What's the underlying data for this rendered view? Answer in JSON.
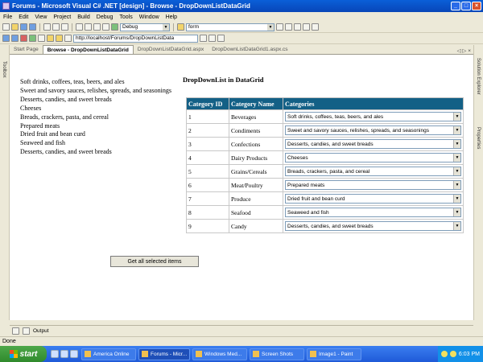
{
  "window": {
    "title": "Forums - Microsoft Visual C# .NET [design] - Browse - DropDownListDataGrid"
  },
  "menu": [
    "File",
    "Edit",
    "View",
    "Project",
    "Build",
    "Debug",
    "Tools",
    "Window",
    "Help"
  ],
  "toolbar": {
    "config": "Debug",
    "find": "form",
    "url": "http://localhost/Forums/DropDownListData"
  },
  "tabs": [
    "Start Page",
    "Browse - DropDownListDataGrid",
    "DropDownListDataGrid.aspx",
    "DropDownListDataGrid1.aspx.cs"
  ],
  "tab_controls": "◁ ▷ ×",
  "side": {
    "toolbox": "Toolbox",
    "solution": "Solution Explorer",
    "properties": "Properties"
  },
  "selected_list": [
    "Soft drinks, coffees, teas, beers, and ales",
    "Sweet and savory sauces, relishes, spreads, and seasonings",
    "Desserts, candies, and sweet breads",
    "Cheeses",
    "Breads, crackers, pasta, and cereal",
    "Prepared meats",
    "Dried fruit and bean curd",
    "Seaweed and fish",
    "Desserts, candies, and sweet breads"
  ],
  "grid": {
    "title": "DropDownList in DataGrid",
    "headers": [
      "Category ID",
      "Category Name",
      "Categories"
    ],
    "rows": [
      {
        "id": "1",
        "name": "Beverages",
        "selected": "Soft drinks, coffees, teas, beers, and ales"
      },
      {
        "id": "2",
        "name": "Condiments",
        "selected": "Sweet and savory sauces, relishes, spreads, and seasonings"
      },
      {
        "id": "3",
        "name": "Confections",
        "selected": "Desserts, candies, and sweet breads"
      },
      {
        "id": "4",
        "name": "Dairy Products",
        "selected": "Cheeses"
      },
      {
        "id": "5",
        "name": "Grains/Cereals",
        "selected": "Breads, crackers, pasta, and cereal"
      },
      {
        "id": "6",
        "name": "Meat/Poultry",
        "selected": "Prepared meats"
      },
      {
        "id": "7",
        "name": "Produce",
        "selected": "Dried fruit and bean curd"
      },
      {
        "id": "8",
        "name": "Seafood",
        "selected": "Seaweed and fish"
      },
      {
        "id": "9",
        "name": "Candy",
        "selected": "Desserts, candies, and sweet breads"
      }
    ]
  },
  "button": {
    "label": "Get all selected items"
  },
  "output_label": "Output",
  "status": "Done",
  "taskbar": {
    "start": "start",
    "tasks": [
      "America Online",
      "Forums - Micr...",
      "Windows Med...",
      "Screen Shots",
      "Image1 - Paint"
    ],
    "active_task": 1,
    "clock": "6:03 PM"
  },
  "colors": {
    "grid_header": "#136086",
    "title_bar": "#0a5fd8",
    "taskbar": "#2a68e0"
  }
}
